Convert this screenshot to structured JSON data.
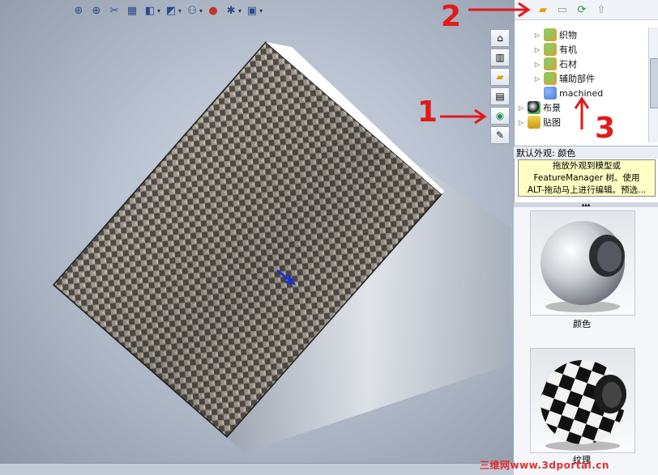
{
  "toolbar": {
    "icons": [
      "zoom-to-fit-icon",
      "zoom-area-icon",
      "section-view-icon",
      "view-orientation-icon",
      "display-style-icon",
      "hide-show-icon",
      "edit-appearance-icon",
      "apply-scene-icon",
      "view-settings-icon"
    ]
  },
  "task_tabs": [
    "home-icon",
    "design-library-icon",
    "file-explorer-icon",
    "view-palette-icon",
    "appearances-icon",
    "custom-properties-icon"
  ],
  "panel_toolbar": [
    "add-folder-icon",
    "open-folder-icon",
    "refresh-icon",
    "up-arrow-icon"
  ],
  "tree": {
    "items": [
      {
        "label": "织物"
      },
      {
        "label": "有机"
      },
      {
        "label": "石材"
      },
      {
        "label": "辅助部件"
      },
      {
        "label": "machined"
      },
      {
        "label": "布景"
      },
      {
        "label": "贴图"
      }
    ]
  },
  "appearance_section": {
    "title": "默认外观: 颜色",
    "tooltip": [
      "拖放外观到模型或",
      "FeatureManager 树。使用",
      "ALT-拖动马上进行编辑。预选..."
    ]
  },
  "swatches": [
    {
      "caption": "颜色"
    },
    {
      "caption": "纹理"
    }
  ],
  "annotations": [
    "1",
    "2",
    "3"
  ],
  "watermark": "三维网www.3dportal.cn",
  "colors": {
    "annotation": "#e21a1a",
    "tooltip_bg": "#ffffc4"
  }
}
